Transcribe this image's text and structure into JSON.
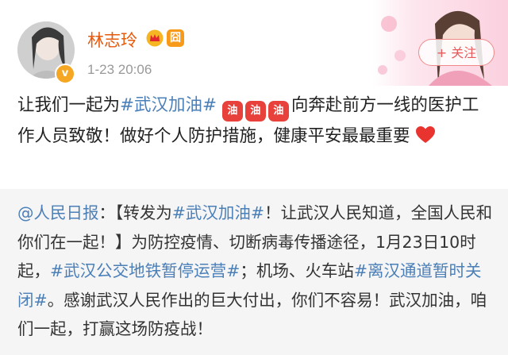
{
  "post": {
    "author": {
      "name": "林志玲",
      "verified_badge": "v",
      "member_badge": "囧",
      "icons": [
        "crown-icon",
        "member-icon",
        "verified-icon"
      ]
    },
    "timestamp": "1-23 20:06",
    "follow_label": "+ 关注",
    "text": {
      "part1": "让我们一起为",
      "topic": "#武汉加油#",
      "emoji": [
        "coffee-fuel-emoji",
        "coffee-fuel-emoji",
        "coffee-fuel-emoji"
      ],
      "emoji_glyph": "油",
      "part2": "向奔赴前方一线的医护工作人员致敬！做好个人防护措施，健康平安最最重要",
      "end_icon": "heart-icon"
    },
    "repost": {
      "mention": "@人民日报",
      "sep": "：【转发为",
      "topic1": "#武汉加油#",
      "t1": "！让武汉人民知道，全国人民和你们在一起！】为防控疫情、切断病毒传播途径，1月23日10时起，",
      "topic2": "#武汉公交地铁暂停运营#",
      "t2": "；机场、火车站",
      "topic3": "#离汉通道暂时关闭#",
      "t3": "。感谢武汉人民作出的巨大付出，你们不容易！武汉加油，咱们一起，打赢这场防疫战！"
    }
  },
  "colors": {
    "username": "#e8590c",
    "topic": "#4a7fb8",
    "repost_bg": "#f5f5f5",
    "follow": "#e85a5a"
  }
}
